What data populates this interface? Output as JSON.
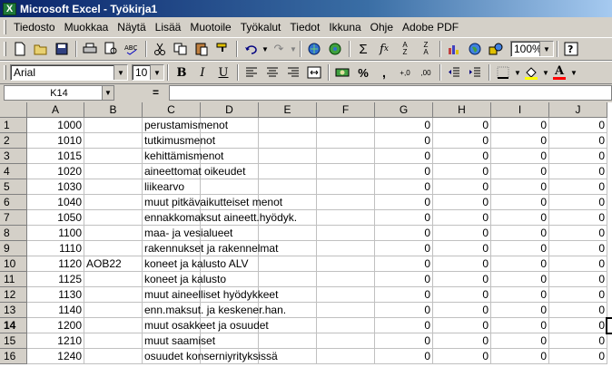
{
  "window": {
    "title": "Microsoft Excel - Työkirja1"
  },
  "menu": [
    "Tiedosto",
    "Muokkaa",
    "Näytä",
    "Lisää",
    "Muotoile",
    "Työkalut",
    "Tiedot",
    "Ikkuna",
    "Ohje",
    "Adobe PDF"
  ],
  "toolbar": {
    "zoom": "100%"
  },
  "format": {
    "font": "Arial",
    "size": "10"
  },
  "formula": {
    "namebox": "K14",
    "eq": "=",
    "value": ""
  },
  "columns": [
    "A",
    "B",
    "C",
    "D",
    "E",
    "F",
    "G",
    "H",
    "I",
    "J"
  ],
  "rows": [
    {
      "n": "1",
      "a": "1000",
      "b": "",
      "c": "perustamismenot",
      "g": "0",
      "h": "0",
      "i": "0",
      "j": "0"
    },
    {
      "n": "2",
      "a": "1010",
      "b": "",
      "c": "tutkimusmenot",
      "g": "0",
      "h": "0",
      "i": "0",
      "j": "0"
    },
    {
      "n": "3",
      "a": "1015",
      "b": "",
      "c": "kehittämismenot",
      "g": "0",
      "h": "0",
      "i": "0",
      "j": "0"
    },
    {
      "n": "4",
      "a": "1020",
      "b": "",
      "c": "aineettomat oikeudet",
      "g": "0",
      "h": "0",
      "i": "0",
      "j": "0"
    },
    {
      "n": "5",
      "a": "1030",
      "b": "",
      "c": "liikearvo",
      "g": "0",
      "h": "0",
      "i": "0",
      "j": "0"
    },
    {
      "n": "6",
      "a": "1040",
      "b": "",
      "c": "muut pitkävaikutteiset menot",
      "g": "0",
      "h": "0",
      "i": "0",
      "j": "0"
    },
    {
      "n": "7",
      "a": "1050",
      "b": "",
      "c": "ennakkomaksut aineett.hyödyk.",
      "g": "0",
      "h": "0",
      "i": "0",
      "j": "0"
    },
    {
      "n": "8",
      "a": "1100",
      "b": "",
      "c": "maa- ja vesialueet",
      "g": "0",
      "h": "0",
      "i": "0",
      "j": "0"
    },
    {
      "n": "9",
      "a": "1110",
      "b": "",
      "c": "rakennukset ja rakennelmat",
      "g": "0",
      "h": "0",
      "i": "0",
      "j": "0"
    },
    {
      "n": "10",
      "a": "1120",
      "b": "AOB22",
      "c": "koneet ja kalusto ALV",
      "g": "0",
      "h": "0",
      "i": "0",
      "j": "0"
    },
    {
      "n": "11",
      "a": "1125",
      "b": "",
      "c": "koneet ja kalusto",
      "g": "0",
      "h": "0",
      "i": "0",
      "j": "0"
    },
    {
      "n": "12",
      "a": "1130",
      "b": "",
      "c": "muut aineelliset hyödykkeet",
      "g": "0",
      "h": "0",
      "i": "0",
      "j": "0"
    },
    {
      "n": "13",
      "a": "1140",
      "b": "",
      "c": "enn.maksut. ja keskener.han.",
      "g": "0",
      "h": "0",
      "i": "0",
      "j": "0"
    },
    {
      "n": "14",
      "a": "1200",
      "b": "",
      "c": "muut osakkeet ja osuudet",
      "g": "0",
      "h": "0",
      "i": "0",
      "j": "0"
    },
    {
      "n": "15",
      "a": "1210",
      "b": "",
      "c": "muut saamiset",
      "g": "0",
      "h": "0",
      "i": "0",
      "j": "0"
    },
    {
      "n": "16",
      "a": "1240",
      "b": "",
      "c": "osuudet konserniyrityksissä",
      "g": "0",
      "h": "0",
      "i": "0",
      "j": "0"
    }
  ]
}
